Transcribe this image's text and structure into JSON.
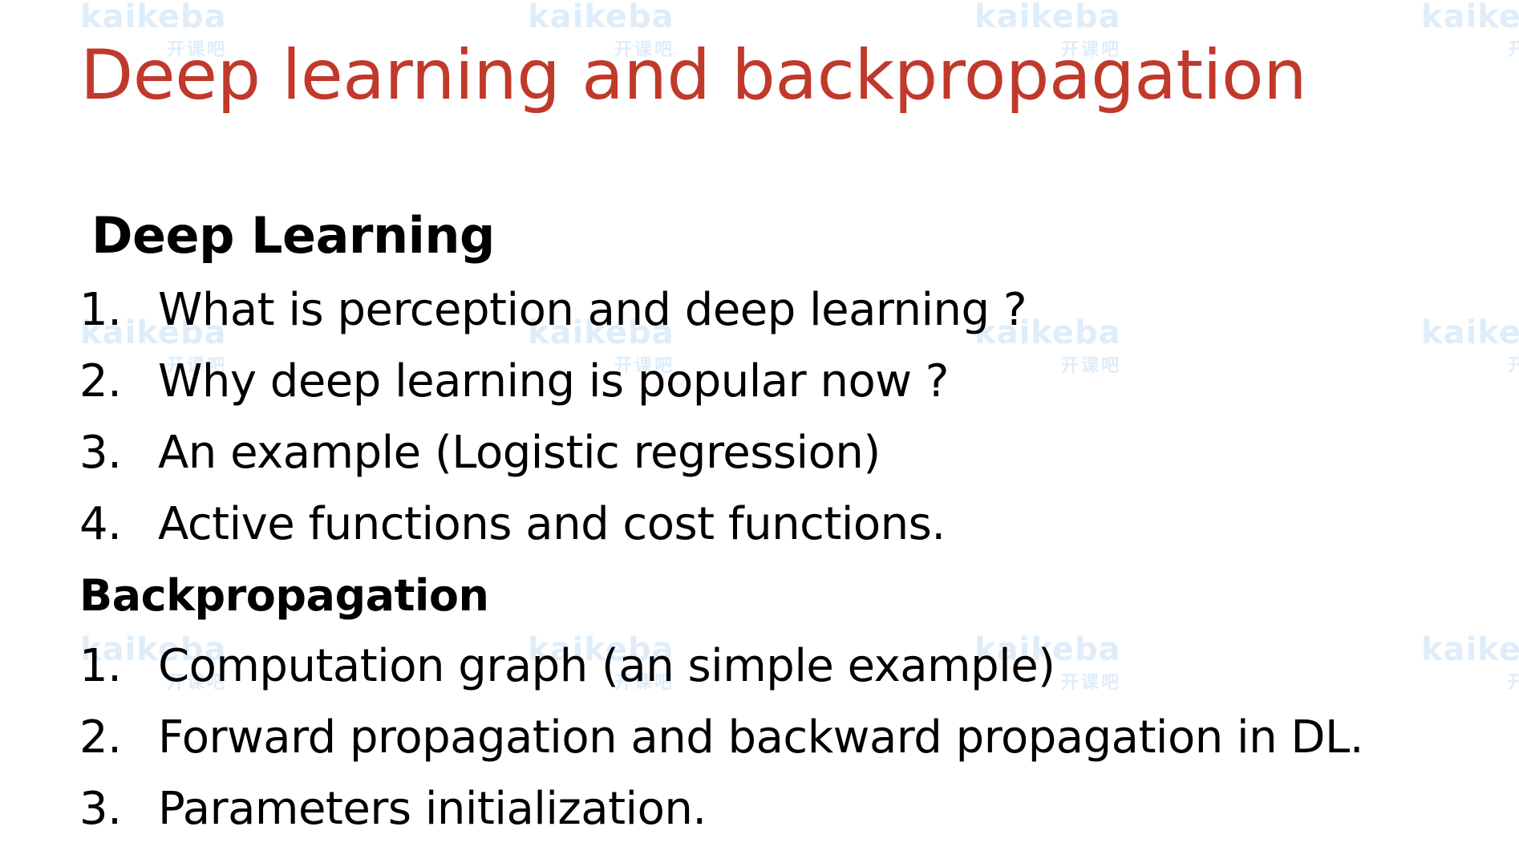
{
  "watermark": {
    "text": "kaikeba",
    "subtext": "开课吧",
    "color": "#6fb0e8"
  },
  "slide": {
    "title": "Deep learning and backpropagation",
    "title_color": "#c0392b",
    "sections": [
      {
        "heading": "Deep Learning",
        "items": [
          {
            "num": "1.",
            "text": "What is perception and deep learning ?"
          },
          {
            "num": "2.",
            "text": "Why deep learning is popular now ?"
          },
          {
            "num": "3.",
            "text": "An example (Logistic regression)"
          },
          {
            "num": "4.",
            "text": "Active functions and cost functions."
          }
        ]
      },
      {
        "heading": "Backpropagation",
        "items": [
          {
            "num": "1.",
            "text": "Computation graph (an simple example)"
          },
          {
            "num": "2.",
            "text": "Forward propagation and backward propagation in DL."
          },
          {
            "num": "3.",
            "text": "Parameters initialization."
          }
        ]
      }
    ]
  }
}
